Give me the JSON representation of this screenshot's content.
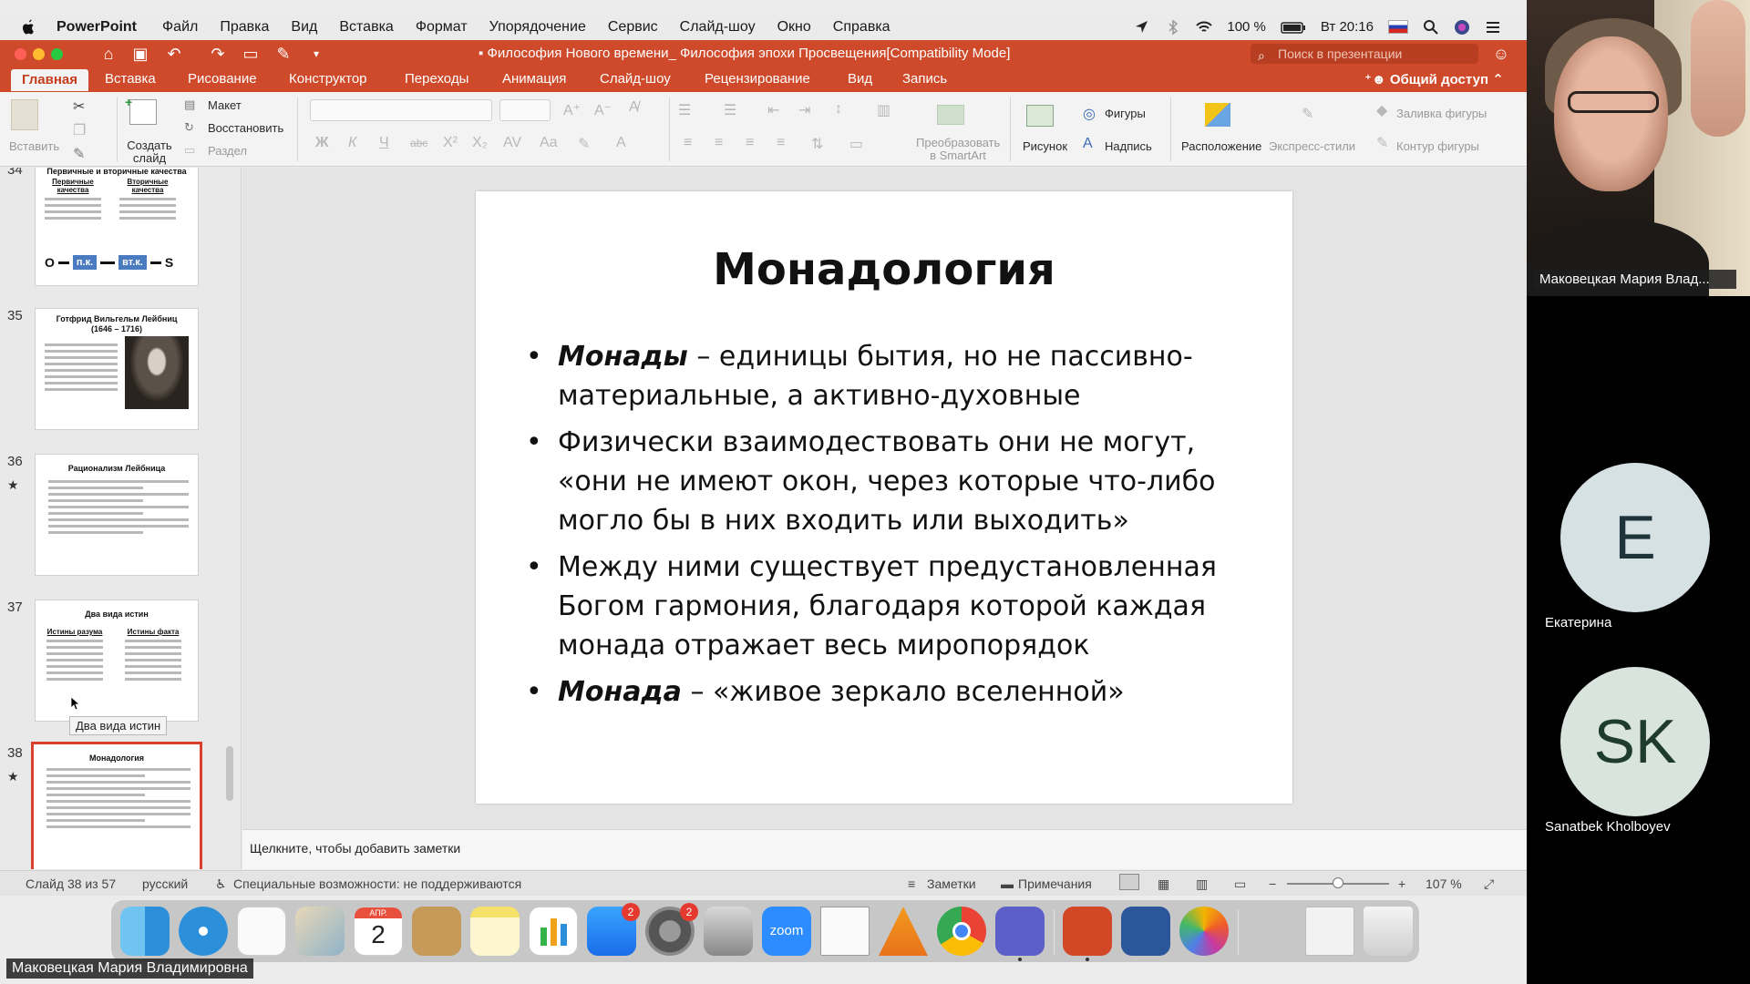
{
  "menubar": {
    "app_name": "PowerPoint",
    "items": [
      "Файл",
      "Правка",
      "Вид",
      "Вставка",
      "Формат",
      "Упорядочение",
      "Сервис",
      "Слайд-шоу",
      "Окно",
      "Справка"
    ],
    "battery": "100 %",
    "clock": "Вт 20:16"
  },
  "window": {
    "title": "Философия Нового времени_ Философия эпохи Просвещения[Compatibility Mode]",
    "search_placeholder": "Поиск в презентации"
  },
  "ribbon_tabs": {
    "tabs": [
      "Главная",
      "Вставка",
      "Рисование",
      "Конструктор",
      "Переходы",
      "Анимация",
      "Слайд-шоу",
      "Рецензирование",
      "Вид",
      "Запись"
    ],
    "active": "Главная",
    "share": "Общий доступ"
  },
  "ribbon": {
    "paste": "Вставить",
    "new_slide": "Создать слайд",
    "layout": "Макет",
    "reset": "Восстановить",
    "section": "Раздел",
    "smartart": "Преобразовать в SmartArt",
    "picture": "Рисунок",
    "shapes": "Фигуры",
    "textbox": "Надпись",
    "arrange": "Расположение",
    "quick_styles": "Экспресс-стили",
    "shape_fill": "Заливка фигуры",
    "shape_outline": "Контур фигуры"
  },
  "thumbnails": [
    {
      "number": "34",
      "title": "Первичные и вторичные качества",
      "col_left": "Первичные качества",
      "col_right": "Вторичные качества",
      "diagram": [
        "O",
        "п.к.",
        "вт.к.",
        "S"
      ]
    },
    {
      "number": "35",
      "title": "Готфрид Вильгельм Лейбниц (1646 – 1716)"
    },
    {
      "number": "36",
      "title": "Рационализм Лейбница"
    },
    {
      "number": "37",
      "title": "Два вида истин",
      "col_left": "Истины разума",
      "col_right": "Истины факта",
      "tooltip": "Два вида истин"
    },
    {
      "number": "38",
      "title": "Монадология",
      "selected": true
    }
  ],
  "slide": {
    "title": "Монадология",
    "bullets": [
      {
        "term": "Монады",
        "text": " – единицы бытия, но не пассивно-материальные, а активно-духовные"
      },
      {
        "term": "",
        "text": "Физически взаимодествовать они не могут, «они не имеют окон, через которые что-либо могло бы в них входить или выходить»"
      },
      {
        "term": "",
        "text": "Между ними существует предустановленная Богом гармония, благодаря которой каждая монада отражает весь миропорядок"
      },
      {
        "term": "Монада",
        "text": " – «живое зеркало вселенной»"
      }
    ]
  },
  "notes_placeholder": "Щелкните, чтобы добавить заметки",
  "statusbar": {
    "slide_counter": "Слайд 38 из 57",
    "language": "русский",
    "accessibility": "Специальные возможности: не поддерживаются",
    "notes": "Заметки",
    "comments": "Примечания",
    "zoom": "107 %"
  },
  "dock": {
    "calendar_month": "АПР.",
    "calendar_day": "2",
    "appstore_badge": "2",
    "settings_badge": "2",
    "zoom_label": "zoom"
  },
  "participants": {
    "presenter_label": "Маковецкая Мария Владимировна",
    "video_name": "Маковецкая Мария Влад...",
    "p1_initial": "E",
    "p1_name": "Екатерина",
    "p2_initial": "SK",
    "p2_name": "Sanatbek Kholboyev"
  },
  "colors": {
    "accent": "#cf4a2b",
    "selected_thumb_border": "#d9412c"
  }
}
